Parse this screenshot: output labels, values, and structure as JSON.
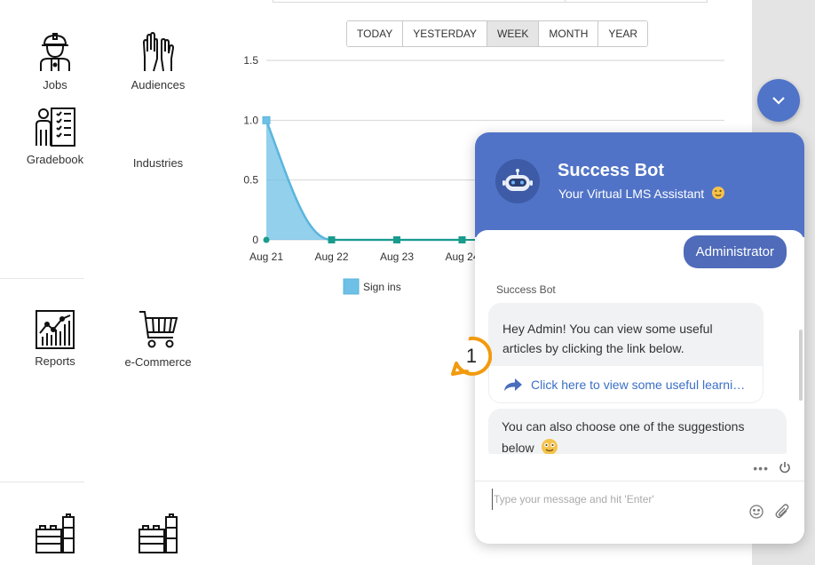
{
  "apps": {
    "jobs": "Jobs",
    "audiences": "Audiences",
    "gradebook": "Gradebook",
    "industries": "Industries",
    "reports": "Reports",
    "ecommerce": "e-Commerce"
  },
  "ranges": {
    "today": "TODAY",
    "yesterday": "YESTERDAY",
    "week": "WEEK",
    "month": "MONTH",
    "year": "YEAR",
    "active": "WEEK"
  },
  "chart_data": {
    "type": "area",
    "categories": [
      "Aug 21",
      "Aug 22",
      "Aug 23",
      "Aug 24"
    ],
    "series": [
      {
        "name": "Sign ins",
        "values": [
          1,
          0,
          0,
          0
        ]
      }
    ],
    "y_ticks": [
      "0",
      "0.5",
      "1.0",
      "1.5"
    ],
    "ylim": [
      0,
      1.5
    ],
    "grid": true,
    "legend": "bottom",
    "colors": {
      "fill": "#6ec0e6",
      "line": "#5bb5dd",
      "marker": "#1a9c8c"
    }
  },
  "chat": {
    "title": "Success Bot",
    "subtitle": "Your Virtual LMS Assistant",
    "user_message": "Administrator",
    "sender": "Success Bot",
    "message1": "Hey Admin! You can view some useful articles by clicking the link below.",
    "link_text": "Click here to view some useful learning articles",
    "message2": "You can also choose one of the suggestions below",
    "input_placeholder": "Type your message and hit 'Enter'",
    "dots": "•••"
  },
  "step_marker": "1",
  "colors": {
    "header": "#5173c7",
    "accent": "#4f74c8",
    "marker": "#f29a0e"
  }
}
